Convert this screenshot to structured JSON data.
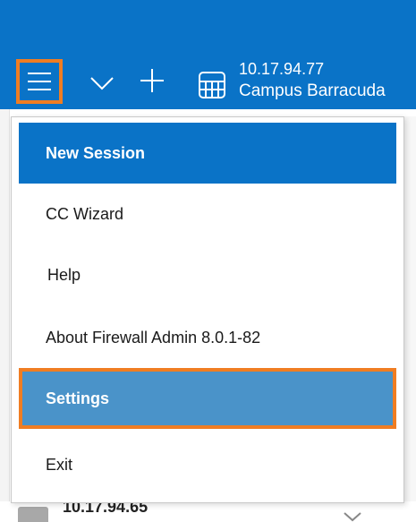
{
  "titlebar": {
    "connection_ip": "10.17.94.77",
    "connection_name": "Campus Barracuda",
    "icons": [
      "hamburger-menu-icon",
      "chevron-down-icon",
      "plus-icon",
      "server-icon"
    ],
    "accent_color": "#0a73c7",
    "highlight_color": "#f07d22"
  },
  "menu": {
    "items": [
      {
        "label": "New Session",
        "state": "active"
      },
      {
        "label": "CC Wizard",
        "state": "normal"
      },
      {
        "label": "Help",
        "state": "normal"
      },
      {
        "label": "About Firewall Admin 8.0.1-82",
        "state": "normal"
      },
      {
        "label": "Settings",
        "state": "selected"
      },
      {
        "label": "Exit",
        "state": "normal"
      }
    ]
  },
  "background_list": {
    "item_ip": "10.17.94.65"
  }
}
